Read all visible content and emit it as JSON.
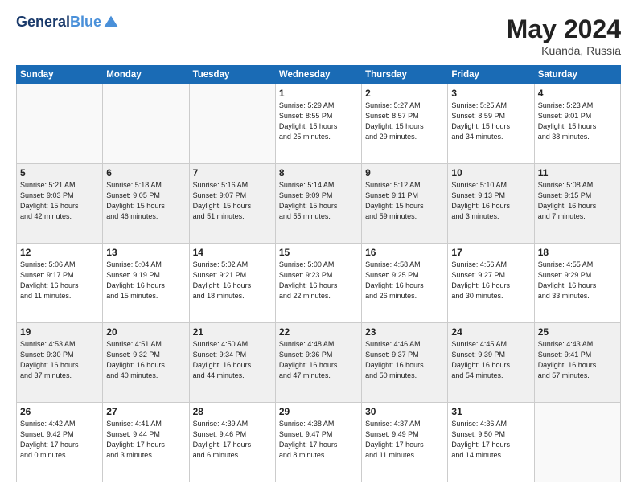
{
  "header": {
    "logo_line1": "General",
    "logo_line2": "Blue",
    "month_year": "May 2024",
    "location": "Kuanda, Russia"
  },
  "weekdays": [
    "Sunday",
    "Monday",
    "Tuesday",
    "Wednesday",
    "Thursday",
    "Friday",
    "Saturday"
  ],
  "weeks": [
    [
      {
        "day": "",
        "info": ""
      },
      {
        "day": "",
        "info": ""
      },
      {
        "day": "",
        "info": ""
      },
      {
        "day": "1",
        "info": "Sunrise: 5:29 AM\nSunset: 8:55 PM\nDaylight: 15 hours\nand 25 minutes."
      },
      {
        "day": "2",
        "info": "Sunrise: 5:27 AM\nSunset: 8:57 PM\nDaylight: 15 hours\nand 29 minutes."
      },
      {
        "day": "3",
        "info": "Sunrise: 5:25 AM\nSunset: 8:59 PM\nDaylight: 15 hours\nand 34 minutes."
      },
      {
        "day": "4",
        "info": "Sunrise: 5:23 AM\nSunset: 9:01 PM\nDaylight: 15 hours\nand 38 minutes."
      }
    ],
    [
      {
        "day": "5",
        "info": "Sunrise: 5:21 AM\nSunset: 9:03 PM\nDaylight: 15 hours\nand 42 minutes."
      },
      {
        "day": "6",
        "info": "Sunrise: 5:18 AM\nSunset: 9:05 PM\nDaylight: 15 hours\nand 46 minutes."
      },
      {
        "day": "7",
        "info": "Sunrise: 5:16 AM\nSunset: 9:07 PM\nDaylight: 15 hours\nand 51 minutes."
      },
      {
        "day": "8",
        "info": "Sunrise: 5:14 AM\nSunset: 9:09 PM\nDaylight: 15 hours\nand 55 minutes."
      },
      {
        "day": "9",
        "info": "Sunrise: 5:12 AM\nSunset: 9:11 PM\nDaylight: 15 hours\nand 59 minutes."
      },
      {
        "day": "10",
        "info": "Sunrise: 5:10 AM\nSunset: 9:13 PM\nDaylight: 16 hours\nand 3 minutes."
      },
      {
        "day": "11",
        "info": "Sunrise: 5:08 AM\nSunset: 9:15 PM\nDaylight: 16 hours\nand 7 minutes."
      }
    ],
    [
      {
        "day": "12",
        "info": "Sunrise: 5:06 AM\nSunset: 9:17 PM\nDaylight: 16 hours\nand 11 minutes."
      },
      {
        "day": "13",
        "info": "Sunrise: 5:04 AM\nSunset: 9:19 PM\nDaylight: 16 hours\nand 15 minutes."
      },
      {
        "day": "14",
        "info": "Sunrise: 5:02 AM\nSunset: 9:21 PM\nDaylight: 16 hours\nand 18 minutes."
      },
      {
        "day": "15",
        "info": "Sunrise: 5:00 AM\nSunset: 9:23 PM\nDaylight: 16 hours\nand 22 minutes."
      },
      {
        "day": "16",
        "info": "Sunrise: 4:58 AM\nSunset: 9:25 PM\nDaylight: 16 hours\nand 26 minutes."
      },
      {
        "day": "17",
        "info": "Sunrise: 4:56 AM\nSunset: 9:27 PM\nDaylight: 16 hours\nand 30 minutes."
      },
      {
        "day": "18",
        "info": "Sunrise: 4:55 AM\nSunset: 9:29 PM\nDaylight: 16 hours\nand 33 minutes."
      }
    ],
    [
      {
        "day": "19",
        "info": "Sunrise: 4:53 AM\nSunset: 9:30 PM\nDaylight: 16 hours\nand 37 minutes."
      },
      {
        "day": "20",
        "info": "Sunrise: 4:51 AM\nSunset: 9:32 PM\nDaylight: 16 hours\nand 40 minutes."
      },
      {
        "day": "21",
        "info": "Sunrise: 4:50 AM\nSunset: 9:34 PM\nDaylight: 16 hours\nand 44 minutes."
      },
      {
        "day": "22",
        "info": "Sunrise: 4:48 AM\nSunset: 9:36 PM\nDaylight: 16 hours\nand 47 minutes."
      },
      {
        "day": "23",
        "info": "Sunrise: 4:46 AM\nSunset: 9:37 PM\nDaylight: 16 hours\nand 50 minutes."
      },
      {
        "day": "24",
        "info": "Sunrise: 4:45 AM\nSunset: 9:39 PM\nDaylight: 16 hours\nand 54 minutes."
      },
      {
        "day": "25",
        "info": "Sunrise: 4:43 AM\nSunset: 9:41 PM\nDaylight: 16 hours\nand 57 minutes."
      }
    ],
    [
      {
        "day": "26",
        "info": "Sunrise: 4:42 AM\nSunset: 9:42 PM\nDaylight: 17 hours\nand 0 minutes."
      },
      {
        "day": "27",
        "info": "Sunrise: 4:41 AM\nSunset: 9:44 PM\nDaylight: 17 hours\nand 3 minutes."
      },
      {
        "day": "28",
        "info": "Sunrise: 4:39 AM\nSunset: 9:46 PM\nDaylight: 17 hours\nand 6 minutes."
      },
      {
        "day": "29",
        "info": "Sunrise: 4:38 AM\nSunset: 9:47 PM\nDaylight: 17 hours\nand 8 minutes."
      },
      {
        "day": "30",
        "info": "Sunrise: 4:37 AM\nSunset: 9:49 PM\nDaylight: 17 hours\nand 11 minutes."
      },
      {
        "day": "31",
        "info": "Sunrise: 4:36 AM\nSunset: 9:50 PM\nDaylight: 17 hours\nand 14 minutes."
      },
      {
        "day": "",
        "info": ""
      }
    ]
  ]
}
